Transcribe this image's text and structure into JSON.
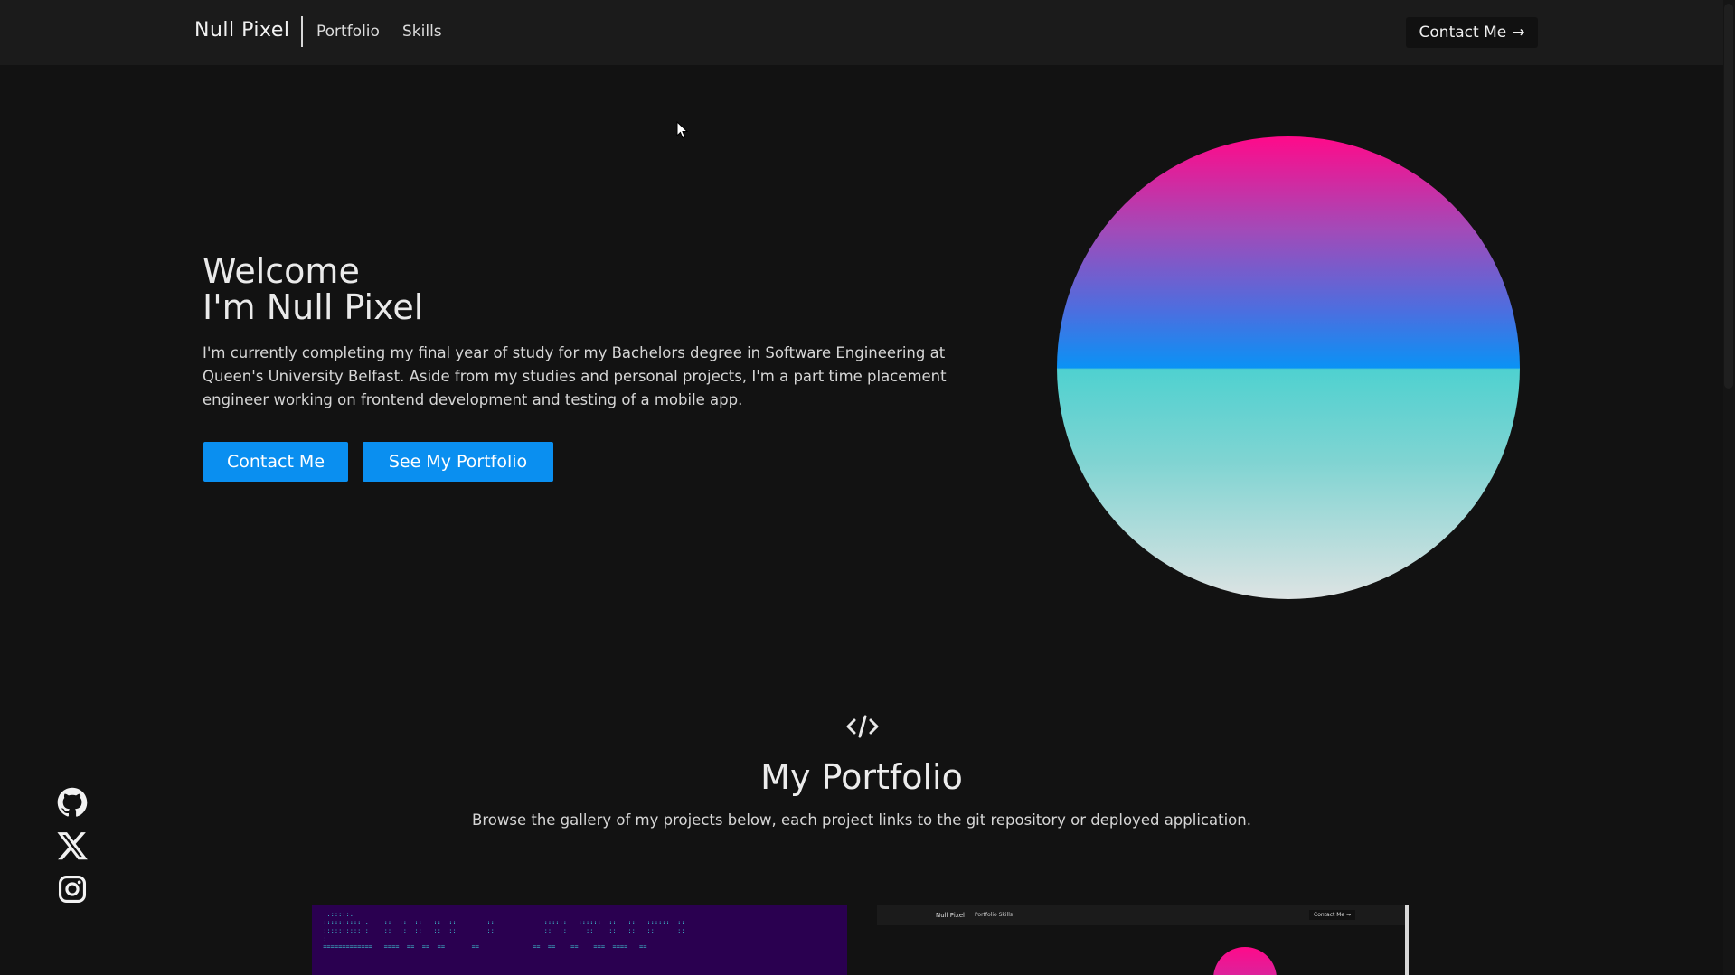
{
  "nav": {
    "brand": "Null Pixel",
    "links": [
      "Portfolio",
      "Skills"
    ],
    "contact_label": "Contact Me",
    "contact_arrow": "→"
  },
  "hero": {
    "title_line1": "Welcome",
    "title_line2": "I'm Null Pixel",
    "description": "I'm currently completing my final year of study for my Bachelors degree in Software Engineering at Queen's University Belfast. Aside from my studies and personal projects, I'm a part time placement engineer working on frontend development and testing of a mobile app.",
    "buttons": [
      "Contact Me",
      "See My Portfolio"
    ]
  },
  "portfolio": {
    "icon": "code-icon",
    "title": "My Portfolio",
    "subtitle": "Browse the gallery of my projects below, each project links to the git repository or deployed application."
  },
  "social": [
    "github-icon",
    "x-icon",
    "instagram-icon"
  ],
  "thumbnails": {
    "second": {
      "brand": "Null Pixel",
      "links": "Portfolio  Skills",
      "contact": "Contact Me →"
    }
  },
  "colors": {
    "accent": "#0a8ff0",
    "background": "#121212",
    "navbar": "#1b1b1b",
    "orb_top": "#ff0a8a",
    "orb_mid": "#0a92f5",
    "orb_lower": "#4fd1d0",
    "orb_bottom": "#dde3e3"
  }
}
